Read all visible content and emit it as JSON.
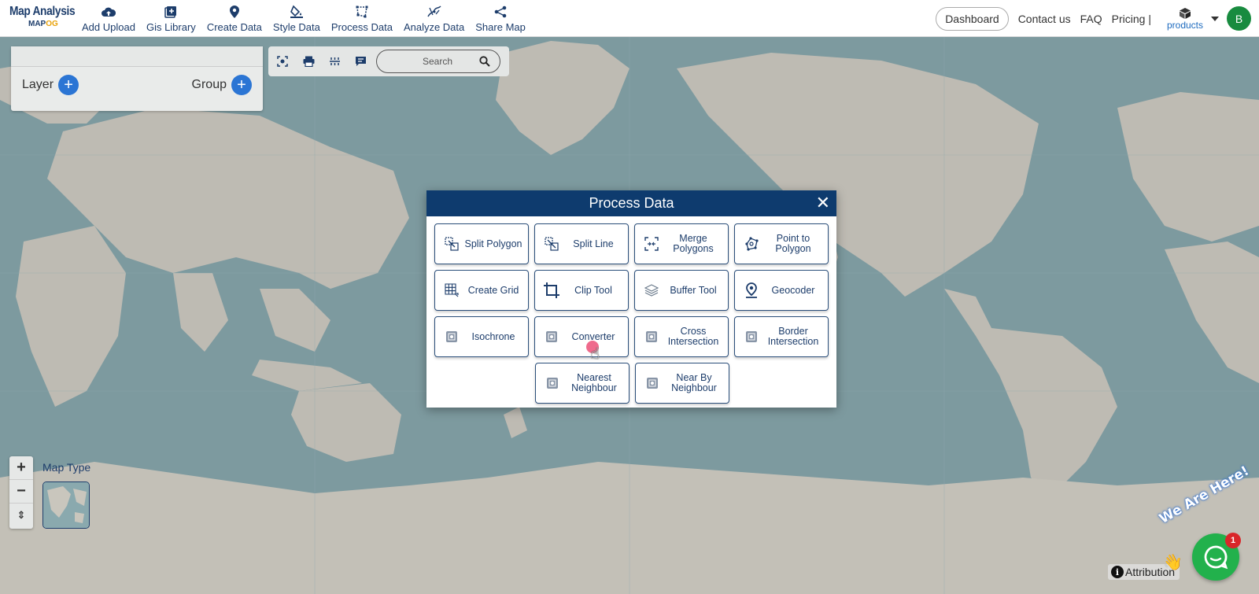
{
  "app": {
    "logo_title": "Map Analysis",
    "logo_sub_a": "MAP",
    "logo_sub_b": "OG"
  },
  "nav": [
    {
      "label": "Add Upload",
      "icon": "cloud-upload-icon"
    },
    {
      "label": "Gis Library",
      "icon": "library-icon"
    },
    {
      "label": "Create Data",
      "icon": "map-pin-icon"
    },
    {
      "label": "Style Data",
      "icon": "paint-bucket-icon"
    },
    {
      "label": "Process Data",
      "icon": "polygon-edit-icon"
    },
    {
      "label": "Analyze Data",
      "icon": "analyze-icon"
    },
    {
      "label": "Share Map",
      "icon": "share-icon"
    }
  ],
  "right_nav": {
    "dashboard": "Dashboard",
    "contact": "Contact us",
    "faq": "FAQ",
    "pricing": "Pricing |",
    "products": "products",
    "avatar_initial": "B"
  },
  "layer_panel": {
    "layer_label": "Layer",
    "group_label": "Group"
  },
  "toolbar": {
    "search_placeholder": "Search"
  },
  "map_controls": {
    "zoom_in": "+",
    "zoom_out": "−",
    "reset": "⇕",
    "map_type_label": "Map Type"
  },
  "modal": {
    "title": "Process Data",
    "close": "✕",
    "tools": [
      {
        "label": "Split Polygon",
        "icon": "split-polygon-icon"
      },
      {
        "label": "Split Line",
        "icon": "split-line-icon"
      },
      {
        "label": "Merge Polygons",
        "icon": "merge-polygons-icon"
      },
      {
        "label": "Point to Polygon",
        "icon": "point-to-polygon-icon"
      },
      {
        "label": "Create Grid",
        "icon": "grid-icon"
      },
      {
        "label": "Clip Tool",
        "icon": "crop-icon"
      },
      {
        "label": "Buffer Tool",
        "icon": "layers-icon"
      },
      {
        "label": "Geocoder",
        "icon": "location-icon"
      },
      {
        "label": "Isochrone",
        "icon": "tool-icon"
      },
      {
        "label": "Converter",
        "icon": "tool-icon"
      },
      {
        "label": "Cross Intersection",
        "icon": "tool-icon"
      },
      {
        "label": "Border Intersection",
        "icon": "tool-icon"
      },
      {
        "label": "Nearest Neighbour",
        "icon": "tool-icon"
      },
      {
        "label": "Near By Neighbour",
        "icon": "tool-icon"
      }
    ]
  },
  "attribution": "Attribution",
  "chat": {
    "badge_count": "1",
    "banner": "We Are Here!"
  }
}
